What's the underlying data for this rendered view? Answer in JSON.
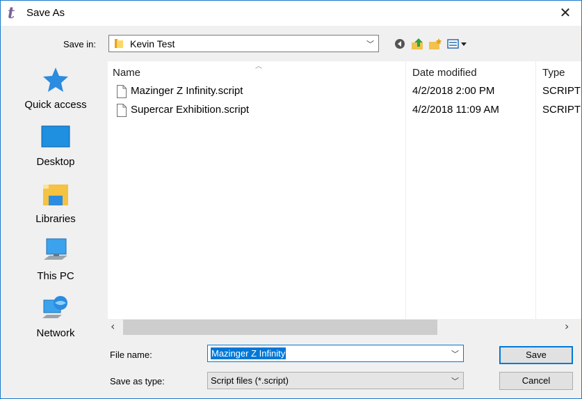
{
  "window": {
    "title": "Save As",
    "app_icon": "t-italic-app-icon",
    "close_glyph": "✕"
  },
  "savein": {
    "label": "Save in:",
    "value": "Kevin Test",
    "folder_icon": "folder-icon"
  },
  "toolbar": [
    {
      "name": "back-icon"
    },
    {
      "name": "up-folder-icon"
    },
    {
      "name": "new-folder-icon"
    },
    {
      "name": "view-menu-icon"
    }
  ],
  "places": [
    {
      "label": "Quick access",
      "icon": "quick-access-star-icon"
    },
    {
      "label": "Desktop",
      "icon": "desktop-icon"
    },
    {
      "label": "Libraries",
      "icon": "libraries-icon"
    },
    {
      "label": "This PC",
      "icon": "this-pc-icon"
    },
    {
      "label": "Network",
      "icon": "network-icon"
    }
  ],
  "filelist": {
    "columns": [
      "Name",
      "Date modified",
      "Type"
    ],
    "files": [
      {
        "name": "Mazinger Z Infinity.script",
        "date": "4/2/2018 2:00 PM",
        "type": "SCRIPT"
      },
      {
        "name": "Supercar Exhibition.script",
        "date": "4/2/2018 11:09 AM",
        "type": "SCRIPT"
      }
    ]
  },
  "filename": {
    "label": "File name:",
    "value": "Mazinger Z Infinity"
  },
  "savetype": {
    "label": "Save as type:",
    "value": "Script files (*.script)"
  },
  "buttons": {
    "save": "Save",
    "cancel": "Cancel"
  },
  "colors": {
    "accent": "#0078d7",
    "border": "#1979ca",
    "dialog_bg": "#f0f0f0"
  }
}
